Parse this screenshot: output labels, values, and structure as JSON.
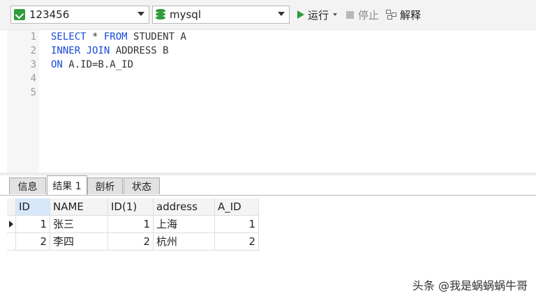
{
  "toolbar": {
    "connection": "123456",
    "database": "mysql",
    "run_label": "运行",
    "stop_label": "停止",
    "explain_label": "解释"
  },
  "editor": {
    "line_numbers": [
      "1",
      "2",
      "3",
      "4",
      "5"
    ],
    "lines": [
      {
        "kw": "SELECT",
        "rest": " * FROM STUDENT A",
        "kw2": "FROM"
      },
      {
        "kw": "INNER JOIN",
        "rest": " ADDRESS B"
      },
      {
        "kw": "ON",
        "rest": " A.ID=B.A_ID"
      }
    ]
  },
  "tabs": [
    "信息",
    "结果 1",
    "剖析",
    "状态"
  ],
  "results": {
    "columns": [
      "ID",
      "NAME",
      "ID(1)",
      "address",
      "A_ID"
    ],
    "rows": [
      [
        "1",
        "张三",
        "1",
        "上海",
        "1"
      ],
      [
        "2",
        "李四",
        "2",
        "杭州",
        "2"
      ]
    ]
  },
  "watermark": "头条 @我是蜗蜗蜗牛哥",
  "colors": {
    "keyword": "#1a49d6",
    "run_icon": "#2e9d3a",
    "db_icon": "#2e9d3a"
  }
}
